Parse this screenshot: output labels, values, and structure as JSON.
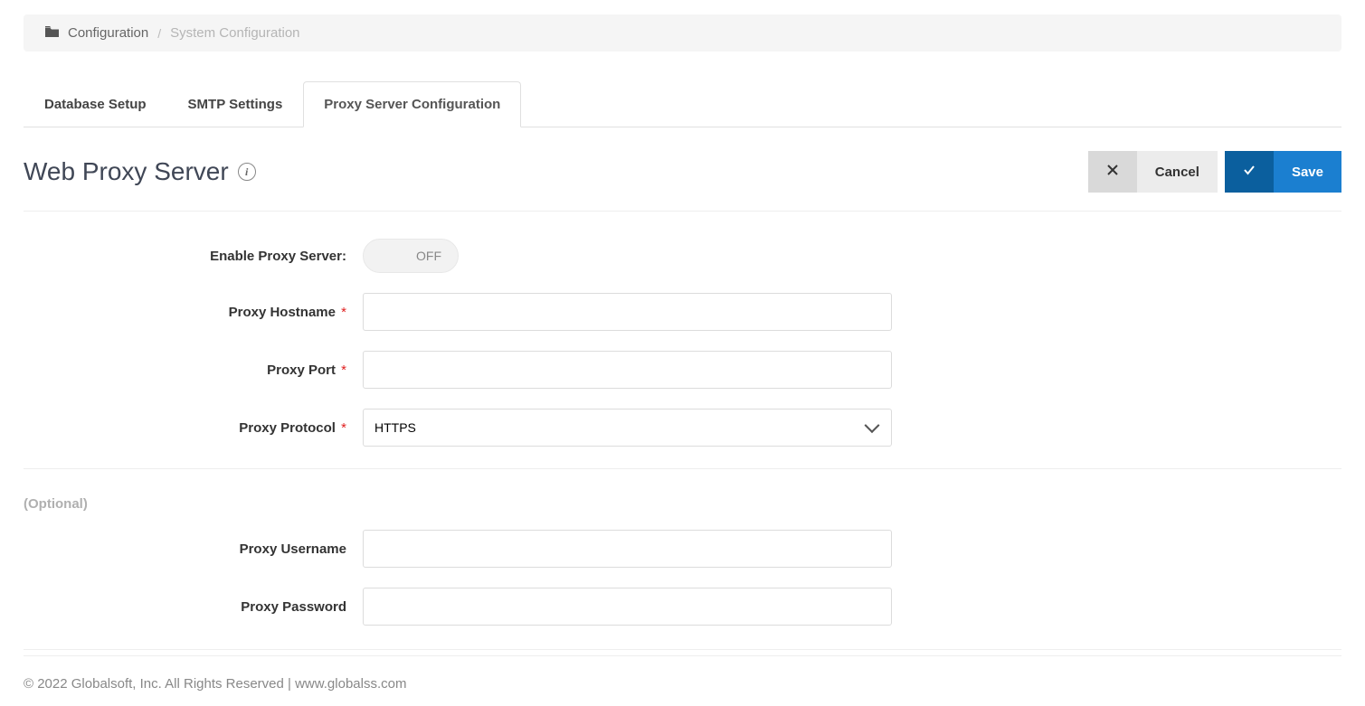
{
  "breadcrumb": {
    "parent": "Configuration",
    "current": "System Configuration"
  },
  "tabs": [
    {
      "label": "Database Setup",
      "active": false
    },
    {
      "label": "SMTP Settings",
      "active": false
    },
    {
      "label": "Proxy Server Configuration",
      "active": true
    }
  ],
  "page": {
    "title": "Web Proxy Server"
  },
  "buttons": {
    "cancel": "Cancel",
    "save": "Save"
  },
  "form": {
    "enable_label": "Enable Proxy Server:",
    "enable_value": "OFF",
    "hostname_label": "Proxy Hostname",
    "hostname_value": "",
    "port_label": "Proxy Port",
    "port_value": "",
    "protocol_label": "Proxy Protocol",
    "protocol_value": "HTTPS",
    "optional_header": "(Optional)",
    "username_label": "Proxy Username",
    "username_value": "",
    "password_label": "Proxy Password",
    "password_value": ""
  },
  "footer": {
    "text": "© 2022 Globalsoft, Inc. All Rights Reserved | www.globalss.com"
  }
}
